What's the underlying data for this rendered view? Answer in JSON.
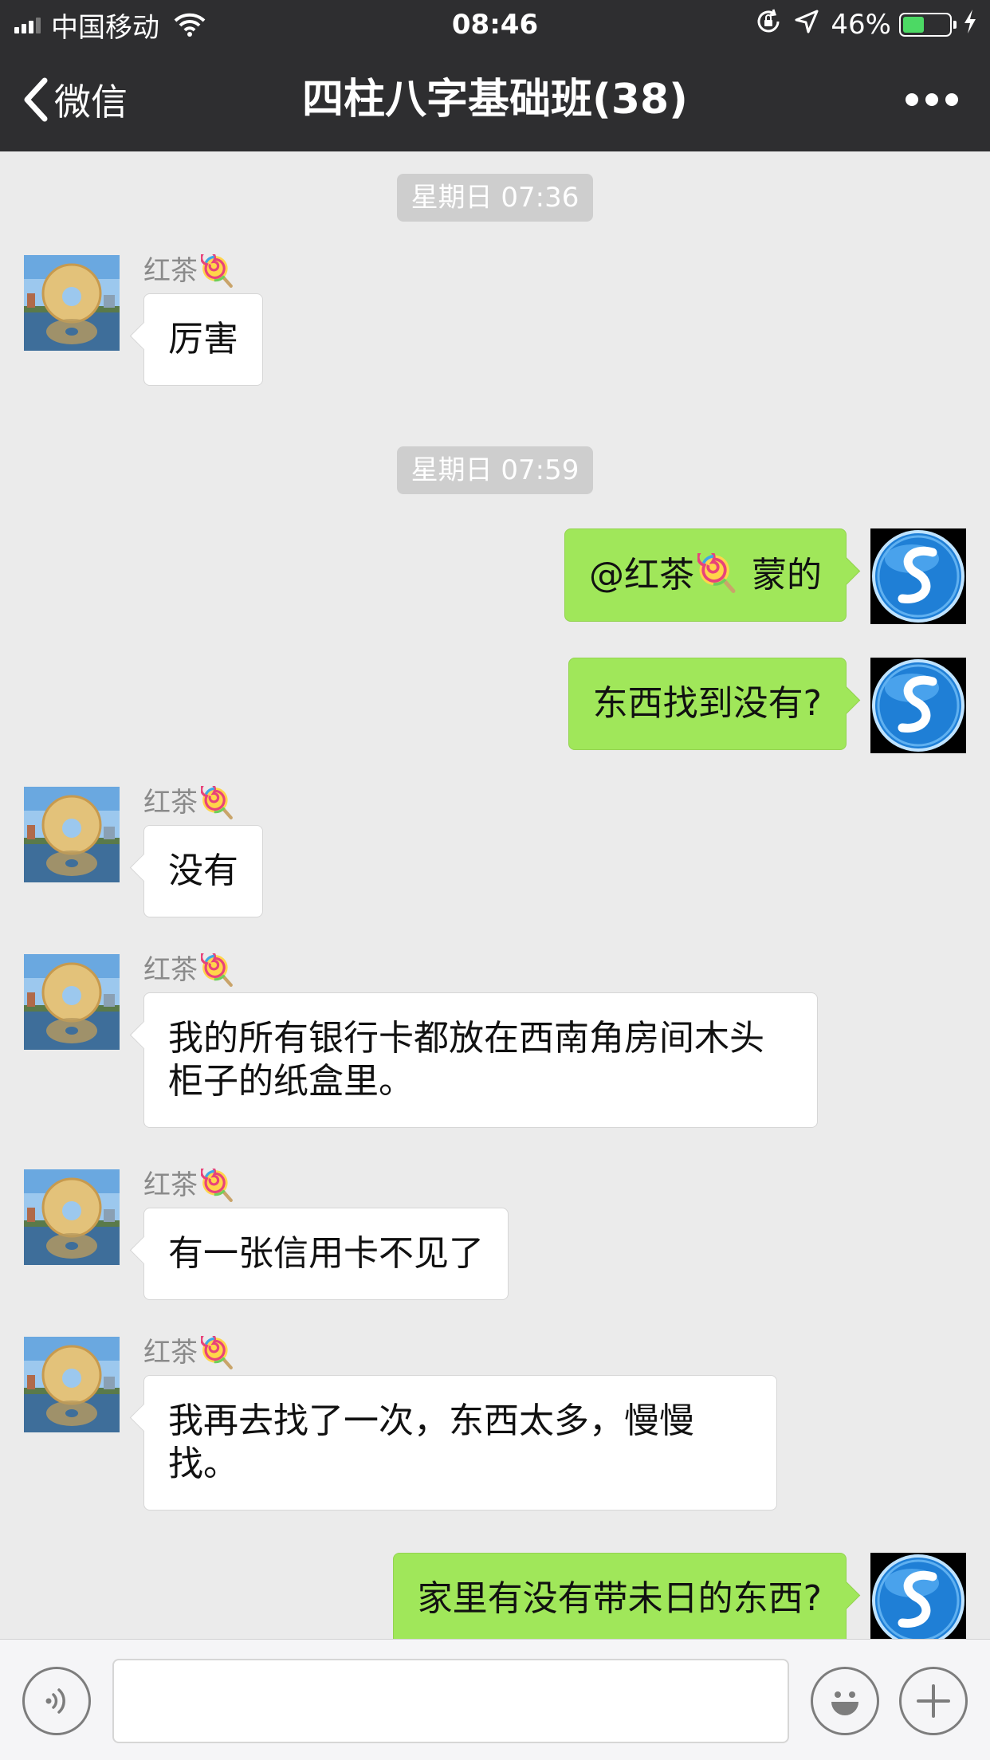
{
  "status_bar": {
    "carrier": "中国移动",
    "time": "08:46",
    "battery": "46%",
    "battery_level": 0.46
  },
  "nav": {
    "back_label": "微信",
    "title": "四柱八字基础班(38)"
  },
  "timestamps": [
    "星期日 07:36",
    "星期日 07:59"
  ],
  "messages": [
    {
      "side": "in",
      "sender": "红茶",
      "text": "厉害"
    },
    {
      "side": "out",
      "mention": "@红茶",
      "text": " 蒙的"
    },
    {
      "side": "out",
      "text": "东西找到没有?"
    },
    {
      "side": "in",
      "sender": "红茶",
      "text": "没有"
    },
    {
      "side": "in",
      "sender": "红茶",
      "text": "我的所有银行卡都放在西南角房间木头柜子的纸盒里。"
    },
    {
      "side": "in",
      "sender": "红茶",
      "text": "有一张信用卡不见了"
    },
    {
      "side": "in",
      "sender": "红茶",
      "text": "我再去找了一次，东西太多，慢慢找。"
    },
    {
      "side": "out",
      "text": "家里有没有带未日的东西?"
    }
  ],
  "input": {
    "value": "",
    "placeholder": ""
  },
  "icons": {
    "voice": "voice-icon",
    "emoji": "emoji-icon",
    "plus": "plus-icon",
    "more": "more-dots-icon",
    "back": "chevron-left-icon",
    "sender_emoji": "lollipop-icon"
  },
  "colors": {
    "header_bg": "#2e2e30",
    "chat_bg": "#ebebeb",
    "out_bubble": "#a0e75a",
    "in_bubble": "#ffffff",
    "battery_fill": "#4cd964"
  }
}
